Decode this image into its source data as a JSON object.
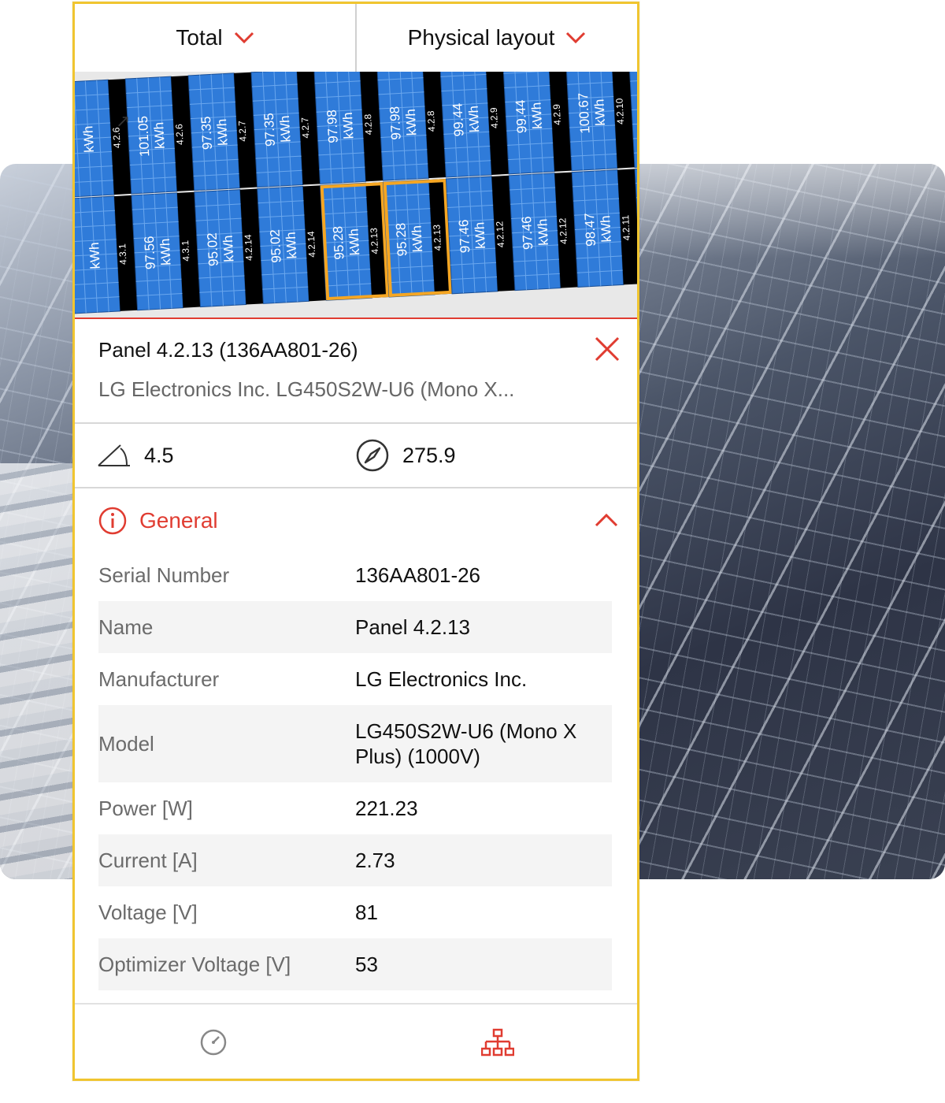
{
  "topbar": {
    "period_label": "Total",
    "view_label": "Physical layout"
  },
  "map": {
    "panel_color": "#2f7bd9",
    "string_color": "#000000",
    "selection_color": "#f5a623",
    "top_row": [
      {
        "string": "4.2.6",
        "value": "kWh"
      },
      {
        "string": "4.2.6",
        "value": "101.05 kWh"
      },
      {
        "string": "4.2.7",
        "value": "97.35 kWh"
      },
      {
        "string": "4.2.7",
        "value": "97.35 kWh"
      },
      {
        "string": "4.2.8",
        "value": "97.98 kWh"
      },
      {
        "string": "4.2.8",
        "value": "97.98 kWh"
      },
      {
        "string": "4.2.9",
        "value": "99.44 kWh"
      },
      {
        "string": "4.2.9",
        "value": "99.44 kWh"
      },
      {
        "string": "4.2.10",
        "value": "100.67 kWh"
      },
      {
        "string": "",
        "value": "100.67"
      }
    ],
    "bottom_row": [
      {
        "string": "4.3.1",
        "value": "kWh"
      },
      {
        "string": "4.3.1",
        "value": "97.56 kWh"
      },
      {
        "string": "4.2.14",
        "value": "95.02 kWh"
      },
      {
        "string": "4.2.14",
        "value": "95.02 kWh"
      },
      {
        "string": "4.2.13",
        "value": "95.28 kWh"
      },
      {
        "string": "4.2.13",
        "value": "95.28 kWh"
      },
      {
        "string": "4.2.12",
        "value": "97.46 kWh"
      },
      {
        "string": "4.2.12",
        "value": "97.46 kWh"
      },
      {
        "string": "4.2.11",
        "value": "98.47 kWh"
      },
      {
        "string": "",
        "value": "98.47"
      }
    ]
  },
  "panel": {
    "title": "Panel 4.2.13 (136AA801-26)",
    "subtitle": "LG Electronics Inc. LG450S2W-U6 (Mono X..."
  },
  "metrics": {
    "tilt": "4.5",
    "azimuth": "275.9"
  },
  "general": {
    "title": "General",
    "accent": "#e03c31",
    "rows": [
      {
        "label": "Serial Number",
        "value": "136AA801-26"
      },
      {
        "label": "Name",
        "value": "Panel 4.2.13"
      },
      {
        "label": "Manufacturer",
        "value": "LG Electronics Inc."
      },
      {
        "label": "Model",
        "value": "LG450S2W-U6 (Mono X Plus) (1000V)"
      },
      {
        "label": "Power [W]",
        "value": "221.23"
      },
      {
        "label": "Current [A]",
        "value": "2.73"
      },
      {
        "label": "Voltage [V]",
        "value": "81"
      },
      {
        "label": "Optimizer Voltage [V]",
        "value": "53"
      }
    ]
  },
  "nav": {
    "items": [
      {
        "icon": "gauge-icon",
        "active": false
      },
      {
        "icon": "hierarchy-icon",
        "active": true
      }
    ]
  }
}
